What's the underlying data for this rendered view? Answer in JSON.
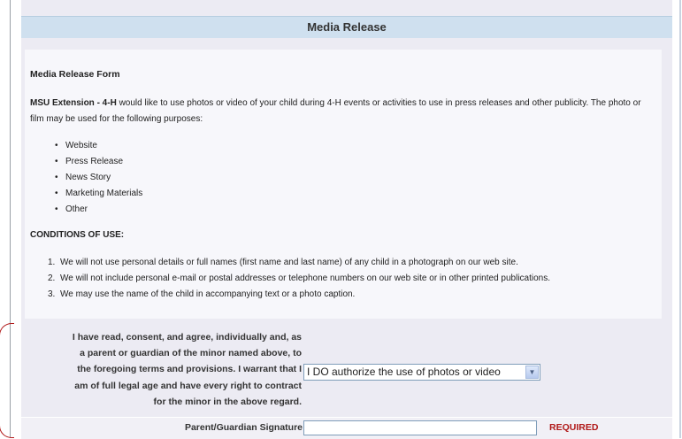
{
  "section": {
    "title": "Media Release"
  },
  "form": {
    "title": "Media Release Form",
    "intro_org": "MSU Extension - 4-H",
    "intro_text": " would like to use photos or video of your child during 4-H events or activities to use in press releases and other publicity.  The photo or film may be used for the following purposes:",
    "purposes": [
      "Website",
      "Press Release",
      "News Story",
      "Marketing Materials",
      "Other"
    ],
    "conditions_title": "CONDITIONS OF USE:",
    "conditions": [
      "We will not use personal details or full names (first name and last name) of any child in a photograph on our web site.",
      "We will not include personal e-mail or postal addresses or telephone numbers on our web site or in other printed publications.",
      "We may use the name of the child in accompanying text or a photo caption."
    ]
  },
  "consent": {
    "lines": [
      "I have read, consent, and agree, individually and, as",
      "a parent or guardian of the minor named above, to",
      "the foregoing terms and provisions. I warrant that I",
      "am of full legal age and have every right to contract",
      "for the minor in the above regard."
    ],
    "select_value": "I DO authorize the use of photos or video"
  },
  "signature": {
    "label": "Parent/Guardian Signature",
    "value": "",
    "required_label": "REQUIRED"
  },
  "colors": {
    "header_bg": "#cfe0ef",
    "panel_bg": "#ecebf3",
    "required": "#b01818"
  }
}
